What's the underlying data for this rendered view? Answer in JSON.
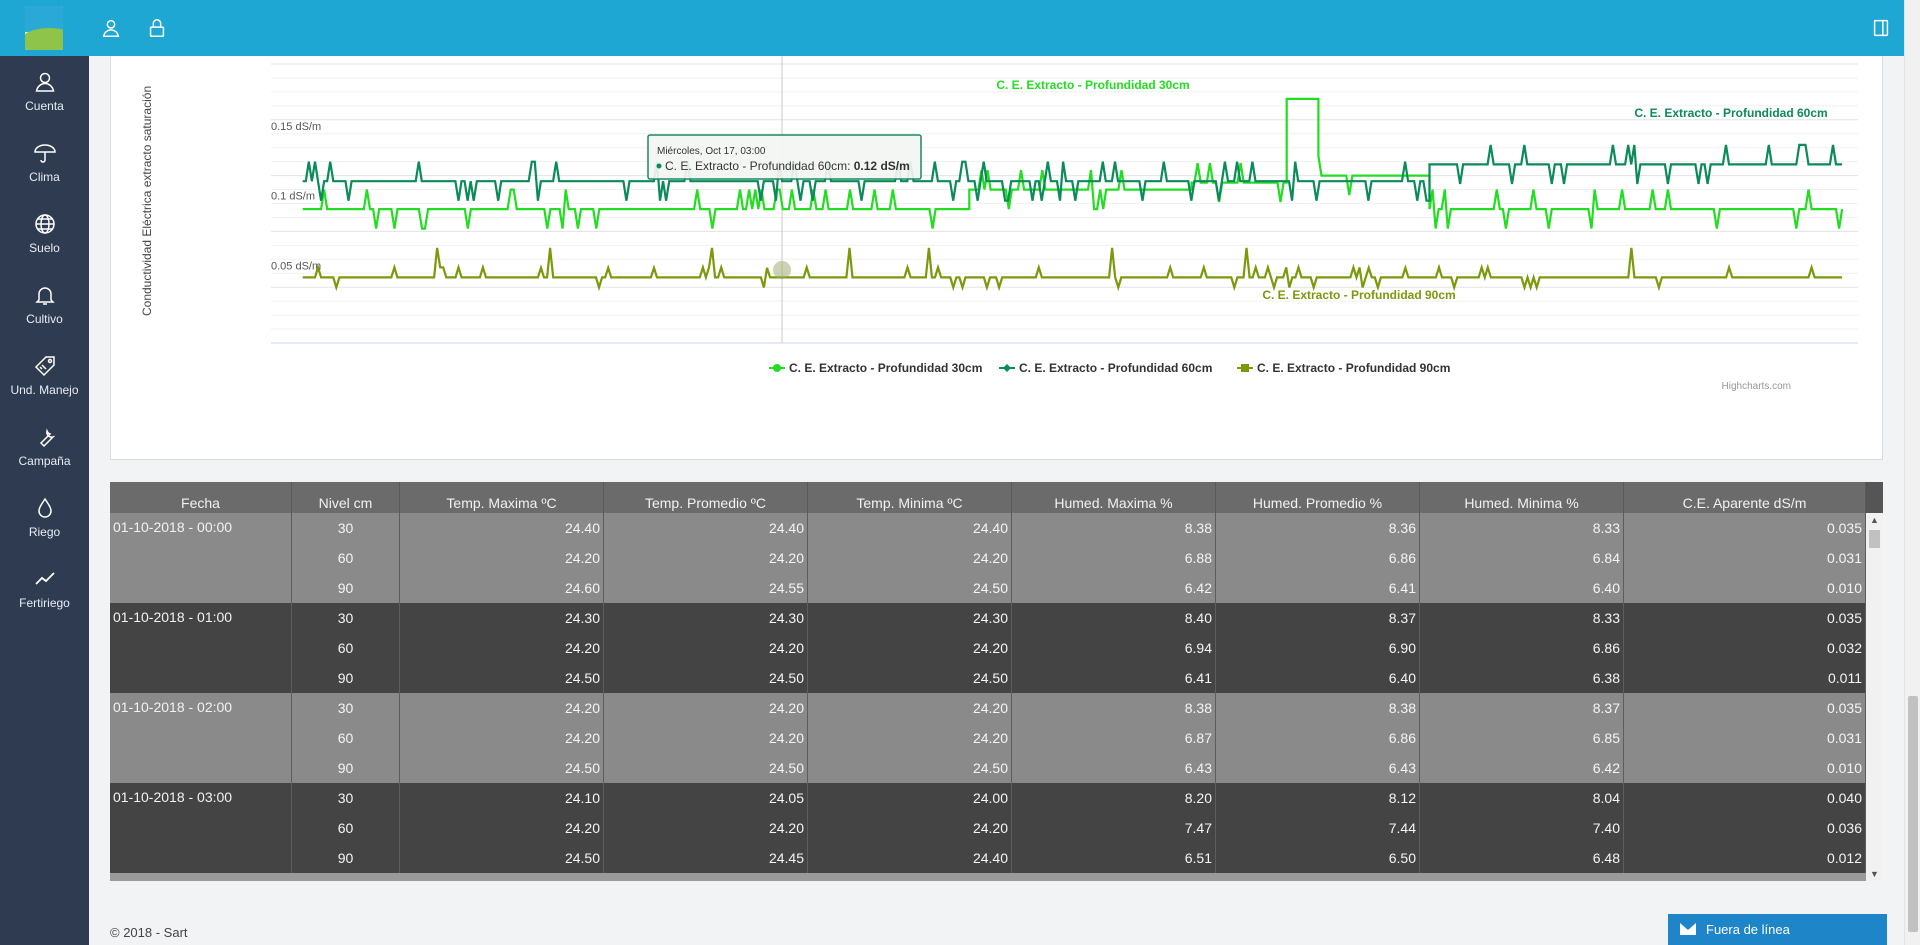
{
  "topbar": {
    "icons": [
      "user-icon",
      "lock-icon",
      "panel-toggle-icon"
    ]
  },
  "sidebar": {
    "items": [
      {
        "label": "Cuenta",
        "icon": "user-icon"
      },
      {
        "label": "Clima",
        "icon": "umbrella-icon"
      },
      {
        "label": "Suelo",
        "icon": "globe-icon"
      },
      {
        "label": "Cultivo",
        "icon": "bell-icon"
      },
      {
        "label": "Und. Manejo",
        "icon": "tag-icon"
      },
      {
        "label": "Campaña",
        "icon": "wrench-icon"
      },
      {
        "label": "Riego",
        "icon": "drop-icon"
      },
      {
        "label": "Fertiriego",
        "icon": "trend-icon"
      }
    ]
  },
  "chart_data": {
    "type": "line",
    "ylabel": "Conductividad Eléctrica extracto saturación",
    "y_ticks": [
      "0.15 dS/m",
      "0.1 dS/m",
      "0.05 dS/m"
    ],
    "ylim": [
      0,
      0.2
    ],
    "grid": true,
    "series": [
      {
        "name": "C. E. Extracto - Profundidad 30cm",
        "color": "#22dd22",
        "base": 0.096,
        "segments": [
          {
            "from": 0.02,
            "to": 0.44,
            "y": 0.096
          },
          {
            "from": 0.44,
            "to": 0.58,
            "y": 0.11
          },
          {
            "from": 0.58,
            "to": 0.64,
            "y": 0.115
          },
          {
            "from": 0.64,
            "to": 0.66,
            "y": 0.175
          },
          {
            "from": 0.66,
            "to": 0.73,
            "y": 0.12
          },
          {
            "from": 0.73,
            "to": 0.99,
            "y": 0.096
          }
        ]
      },
      {
        "name": "C. E. Extracto - Profundidad 60cm",
        "color": "#0b8a5a",
        "segments": [
          {
            "from": 0.02,
            "to": 0.73,
            "y": 0.116
          },
          {
            "from": 0.73,
            "to": 0.99,
            "y": 0.128
          }
        ]
      },
      {
        "name": "C. E. Extracto - Profundidad 90cm",
        "color": "#7a9a0b",
        "segments": [
          {
            "from": 0.02,
            "to": 0.99,
            "y": 0.047
          }
        ]
      }
    ],
    "series_labels": [
      "C. E. Extracto - Profundidad 30cm",
      "C. E. Extracto - Profundidad 60cm",
      "C. E. Extracto - Profundidad 90cm"
    ],
    "tooltip": {
      "header": "Miércoles, Oct 17, 03:00",
      "series": "C. E. Extracto - Profundidad 60cm: ",
      "value": "0.12 dS/m"
    },
    "credits": "Highcharts.com"
  },
  "table": {
    "headers": [
      "Fecha",
      "Nivel cm",
      "Temp. Maxima ºC",
      "Temp. Promedio ºC",
      "Temp. Minima ºC",
      "Humed. Maxima %",
      "Humed. Promedio %",
      "Humed. Minima %",
      "C.E. Aparente dS/m"
    ],
    "groups": [
      {
        "fecha": "01-10-2018 - 00:00",
        "shade": "light",
        "rows": [
          [
            "30",
            "24.40",
            "24.40",
            "24.40",
            "8.38",
            "8.36",
            "8.33",
            "0.035"
          ],
          [
            "60",
            "24.20",
            "24.20",
            "24.20",
            "6.88",
            "6.86",
            "6.84",
            "0.031"
          ],
          [
            "90",
            "24.60",
            "24.55",
            "24.50",
            "6.42",
            "6.41",
            "6.40",
            "0.010"
          ]
        ]
      },
      {
        "fecha": "01-10-2018 - 01:00",
        "shade": "dark",
        "rows": [
          [
            "30",
            "24.30",
            "24.30",
            "24.30",
            "8.40",
            "8.37",
            "8.33",
            "0.035"
          ],
          [
            "60",
            "24.20",
            "24.20",
            "24.20",
            "6.94",
            "6.90",
            "6.86",
            "0.032"
          ],
          [
            "90",
            "24.50",
            "24.50",
            "24.50",
            "6.41",
            "6.40",
            "6.38",
            "0.011"
          ]
        ]
      },
      {
        "fecha": "01-10-2018 - 02:00",
        "shade": "light",
        "rows": [
          [
            "30",
            "24.20",
            "24.20",
            "24.20",
            "8.38",
            "8.38",
            "8.37",
            "0.035"
          ],
          [
            "60",
            "24.20",
            "24.20",
            "24.20",
            "6.87",
            "6.86",
            "6.85",
            "0.031"
          ],
          [
            "90",
            "24.50",
            "24.50",
            "24.50",
            "6.43",
            "6.43",
            "6.42",
            "0.010"
          ]
        ]
      },
      {
        "fecha": "01-10-2018 - 03:00",
        "shade": "dark",
        "rows": [
          [
            "30",
            "24.10",
            "24.05",
            "24.00",
            "8.20",
            "8.12",
            "8.04",
            "0.040"
          ],
          [
            "60",
            "24.20",
            "24.20",
            "24.20",
            "7.47",
            "7.44",
            "7.40",
            "0.036"
          ],
          [
            "90",
            "24.50",
            "24.45",
            "24.40",
            "6.51",
            "6.50",
            "6.48",
            "0.012"
          ]
        ]
      }
    ]
  },
  "footer": {
    "copyright": "© 2018 - Sart"
  },
  "offline_button": {
    "label": "Fuera de línea"
  }
}
